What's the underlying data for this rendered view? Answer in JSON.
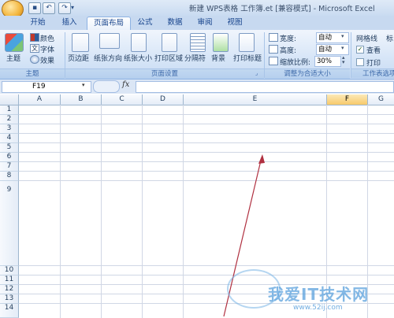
{
  "window": {
    "title": "新建 WPS表格 工作簿.et  [兼容模式] - Microsoft Excel"
  },
  "tabs": [
    "开始",
    "插入",
    "页面布局",
    "公式",
    "数据",
    "审阅",
    "视图"
  ],
  "active_tab": "页面布局",
  "ribbon": {
    "theme_group": {
      "big_button": "主题",
      "colors": "颜色",
      "fonts": "字体",
      "effects": "效果",
      "label": "主题"
    },
    "page_setup_group": {
      "margins": "页边距",
      "orientation": "纸张方向",
      "size": "纸张大小",
      "print_area": "打印区域",
      "breaks": "分隔符",
      "background": "背景",
      "print_titles": "打印标题",
      "label": "页面设置"
    },
    "scale_group": {
      "width_label": "宽度:",
      "width_value": "自动",
      "height_label": "高度:",
      "height_value": "自动",
      "scale_label": "缩放比例:",
      "scale_value": "30%",
      "label": "调整为合适大小"
    },
    "sheet_options_group": {
      "gridlines": "网格线",
      "view": "查看",
      "print": "打印",
      "label": "工作表选项"
    }
  },
  "formula_bar": {
    "name_box": "F19",
    "fx": "fx",
    "content": ""
  },
  "sheet": {
    "columns": [
      "A",
      "B",
      "C",
      "D",
      "E",
      "F",
      "G"
    ],
    "selected_column": "F",
    "rows": [
      "1",
      "2",
      "3",
      "4",
      "5",
      "6",
      "7",
      "8",
      "9",
      "10",
      "11",
      "12",
      "13",
      "14"
    ]
  },
  "watermark": {
    "text": "我爱IT技术网",
    "url": "www.52ij.com"
  }
}
